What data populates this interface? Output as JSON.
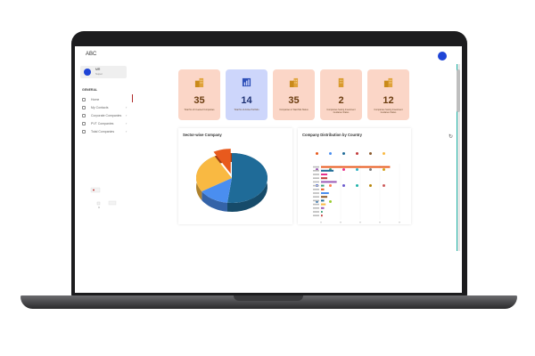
{
  "app": {
    "title": "ABC"
  },
  "user": {
    "name": "MR",
    "role": "Super"
  },
  "sidebar": {
    "section": "GENERAL",
    "items": [
      {
        "label": "Home",
        "icon": "home-icon",
        "active": true
      },
      {
        "label": "My Contacts",
        "icon": "contacts-icon"
      },
      {
        "label": "Corporate Companies",
        "icon": "building-icon"
      },
      {
        "label": "PVT Companies",
        "icon": "briefcase-icon"
      },
      {
        "label": "Total Companies",
        "icon": "list-icon"
      }
    ]
  },
  "cards": [
    {
      "value": "35",
      "label": "Total No of Invested Companies",
      "icon": "building-icon",
      "variant": "peach"
    },
    {
      "value": "14",
      "label": "Total No of Active Portfolio",
      "icon": "chart-icon",
      "variant": "blue"
    },
    {
      "value": "35",
      "label": "Companies in Watchlist Status",
      "icon": "building-icon",
      "variant": "peach"
    },
    {
      "value": "2",
      "label": "Companies having Investment Guidance Status",
      "icon": "building-icon",
      "variant": "peach"
    },
    {
      "value": "12",
      "label": "Companies having Investment Guidance Status",
      "icon": "building-icon",
      "variant": "peach"
    }
  ],
  "panels": {
    "pie_title": "Sector-wise Company",
    "bar_title": "Company Distribution by Country"
  },
  "chart_data": [
    {
      "type": "pie",
      "title": "Sector-wise Company",
      "slices": [
        {
          "value": 52,
          "color": "#1f6b98"
        },
        {
          "value": 14,
          "color": "#4a8ef0"
        },
        {
          "value": 26,
          "color": "#f9b942"
        },
        {
          "value": 8,
          "color": "#e85a1d"
        }
      ]
    },
    {
      "type": "bar",
      "orientation": "horizontal",
      "title": "Company Distribution by Country",
      "xlim": [
        0,
        50
      ],
      "values": [
        44,
        8,
        4,
        4,
        10,
        2,
        2,
        5,
        4,
        2,
        3,
        2,
        1,
        1
      ],
      "bar_colors": [
        "#e85a1d",
        "#1f6b98",
        "#e8338c",
        "#c23b3b",
        "#9b59b6",
        "#3fa27b",
        "#e85a1d",
        "#4a8ef0",
        "#8b5a2b",
        "#1f6b98",
        "#f9b942",
        "#9b59b6",
        "#3fa27b",
        "#c23b3b"
      ],
      "legend_colors": [
        "#e85a1d",
        "#4a8ef0",
        "#1f6b98",
        "#c23b3b",
        "#8b5a2b",
        "#f9b942",
        "#9b59b6",
        "#3fa27b",
        "#e8338c",
        "#2ab0c5",
        "#7a7a7a",
        "#d4a017",
        "#1e44d6",
        "#ff7f50",
        "#6a5acd",
        "#20b2aa",
        "#b8860b",
        "#cd5c5c",
        "#4682b4",
        "#9acd32"
      ]
    }
  ],
  "colors": {
    "accent": "#1e44d6",
    "teal": "#21b5a7"
  }
}
